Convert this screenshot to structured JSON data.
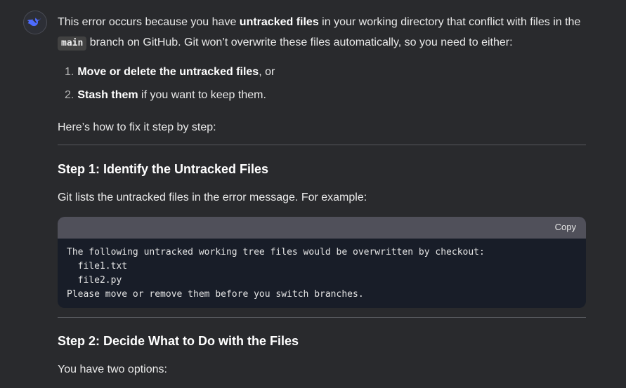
{
  "message": {
    "intro_prefix": "This error occurs because you have ",
    "intro_bold": "untracked files",
    "intro_mid": " in your working directory that conflict with files in the ",
    "intro_code": "main",
    "intro_suffix": " branch on GitHub. Git won’t overwrite these files automatically, so you need to either:",
    "options": [
      {
        "num": "1.",
        "bold": "Move or delete the untracked files",
        "rest": ", or"
      },
      {
        "num": "2.",
        "bold": "Stash them",
        "rest": " if you want to keep them."
      }
    ],
    "howto": "Here’s how to fix it step by step:",
    "step1_heading": "Step 1: Identify the Untracked Files",
    "step1_text": "Git lists the untracked files in the error message. For example:",
    "code": {
      "copy_label": "Copy",
      "lines": [
        "The following untracked working tree files would be overwritten by checkout:",
        "  file1.txt",
        "  file2.py",
        "Please move or remove them before you switch branches."
      ]
    },
    "step2_heading": "Step 2: Decide What to Do with the Files",
    "step2_text": "You have two options:"
  },
  "icons": {
    "avatar": "whale-logo-icon"
  },
  "colors": {
    "background": "#292a2d",
    "accent": "#4d6bfe",
    "code_background": "#181d28",
    "code_header": "#50505a"
  }
}
